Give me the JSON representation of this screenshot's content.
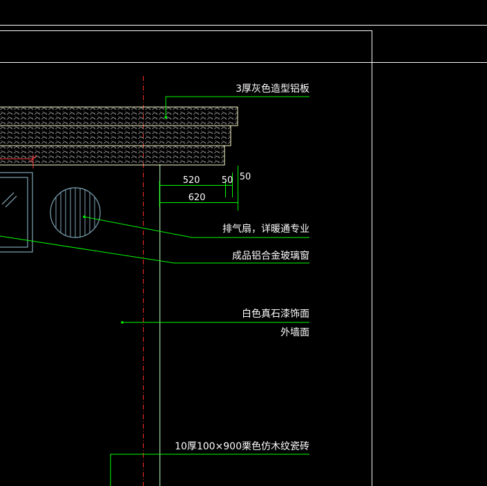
{
  "drawing": {
    "colors": {
      "background": "#000000",
      "frame": "#ffffff",
      "leader": "#00ff00",
      "centerline": "#ff0000",
      "ceiling_outline": "#ffffcc",
      "ceiling_hatch": "#8a8a8a",
      "window": "#7fa6b8",
      "dimension": "#00ff00"
    },
    "annotations": {
      "ceiling_panel": "3厚灰色造型铝板",
      "exhaust_fan": "排气扇，详暖通专业",
      "window": "成品铝合金玻璃窗",
      "wall_finish": "白色真石漆饰面",
      "wall_face": "外墙面",
      "tile": "10厚100×900栗色仿木纹瓷砖"
    },
    "dimensions": {
      "d520": "520",
      "d50a": "50",
      "d50b": "50",
      "d620": "620"
    }
  }
}
